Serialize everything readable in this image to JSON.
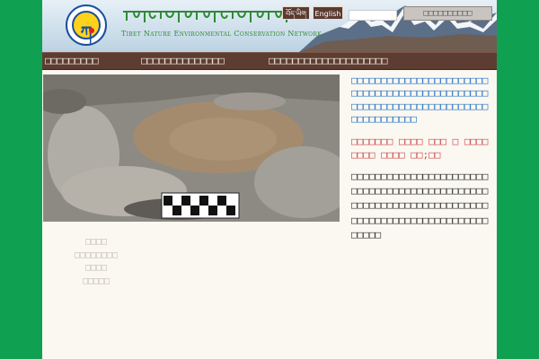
{
  "header": {
    "org_name": "Tibet Nature Environmental Conservation Network",
    "lang_tibetan": "བོད་ཡིག",
    "lang_english": "English",
    "search_placeholder": "",
    "search_button": "□□□□□□□□□□"
  },
  "nav": {
    "items": [
      {
        "label": "□□□□□□□□□"
      },
      {
        "label": "□□□□□□□□□□□□□□"
      },
      {
        "label": "□□□□□□□□□□□□□□□□□□□□"
      }
    ]
  },
  "photo": {
    "alt": ""
  },
  "left_links": [
    "□□□□",
    "□□□□□□□□",
    "□□□□",
    "□□□□□"
  ],
  "article": {
    "summary": "□□□□□□□□□□□□□□□□□□□□□□□□□□□□□□□□□□□□□□□□□□□□□□□□□□□□□□□□□□□□□□□□□□□□□□□□□□□□□□□□",
    "date": "□□□□□□□ □□□□ □□□ □ □□□□ □□□□ □□□□ □□;□□",
    "body": "□□□□□□□□□□□□□□□□□□□□□□□□□□□□□□□□□□□□□□□□□□□□□□□□□□□□□□□□□□□□□□□□□□□□□□□□□□□□□□□□□□□□□□□□□□□□□□□□□"
  },
  "colors": {
    "page_background": "#10a052",
    "nav_bar": "#5d3d31",
    "link_blue": "#2c74c2",
    "date_red": "#cc4b4b",
    "org_green": "#2f8a35"
  },
  "icons": [
    "logo-emblem",
    "mountain-banner"
  ]
}
